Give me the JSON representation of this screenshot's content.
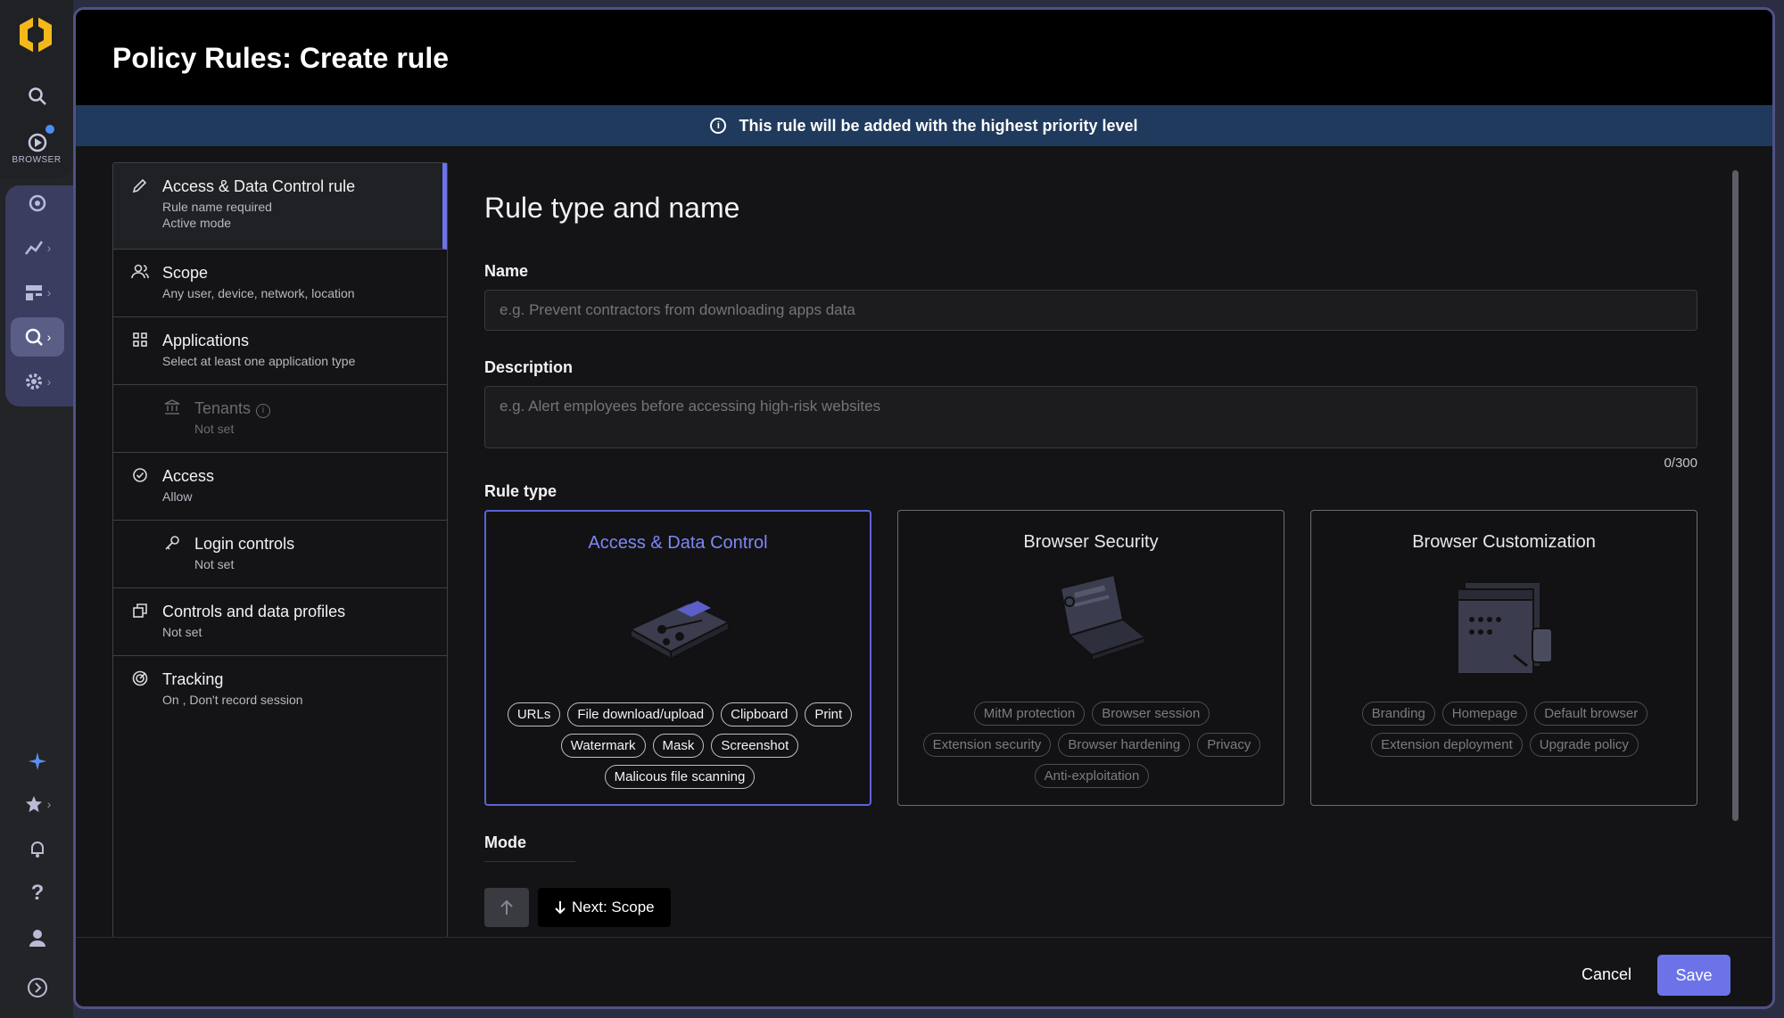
{
  "header": {
    "title": "Policy Rules: Create rule"
  },
  "banner": {
    "text": "This rule will be added with the highest priority level"
  },
  "rail": {
    "browser_label": "BROWSER"
  },
  "steps": [
    {
      "title": "Access & Data Control rule",
      "sub1": "Rule name required",
      "sub2": "Active mode"
    },
    {
      "title": "Scope",
      "sub": "Any user, device, network, location"
    },
    {
      "title": "Applications",
      "sub": "Select at least one application type"
    },
    {
      "title": "Tenants",
      "sub": "Not set"
    },
    {
      "title": "Access",
      "sub": "Allow"
    },
    {
      "title": "Login controls",
      "sub": "Not set"
    },
    {
      "title": "Controls and data profiles",
      "sub": "Not set"
    },
    {
      "title": "Tracking",
      "sub": "On , Don't record session"
    }
  ],
  "form": {
    "section_title": "Rule type and name",
    "name_label": "Name",
    "name_placeholder": "e.g. Prevent contractors from downloading apps data",
    "description_label": "Description",
    "description_placeholder": "e.g. Alert employees before accessing high-risk websites",
    "counter": "0/300",
    "rule_type_label": "Rule type",
    "mode_label": "Mode"
  },
  "rule_types": [
    {
      "title": "Access & Data Control",
      "chips": [
        "URLs",
        "File download/upload",
        "Clipboard",
        "Print",
        "Watermark",
        "Mask",
        "Screenshot",
        "Malicous file scanning"
      ]
    },
    {
      "title": "Browser Security",
      "chips": [
        "MitM protection",
        "Browser session",
        "Extension security",
        "Browser hardening",
        "Privacy",
        "Anti-exploitation"
      ]
    },
    {
      "title": "Browser Customization",
      "chips": [
        "Branding",
        "Homepage",
        "Default browser",
        "Extension deployment",
        "Upgrade policy"
      ]
    }
  ],
  "buttons": {
    "next": "Next: Scope",
    "cancel": "Cancel",
    "save": "Save"
  },
  "colors": {
    "accent": "#6c73e8",
    "banner": "#1f3a5c",
    "rail_group": "#3a3c60",
    "logo": "#f5b81c"
  }
}
